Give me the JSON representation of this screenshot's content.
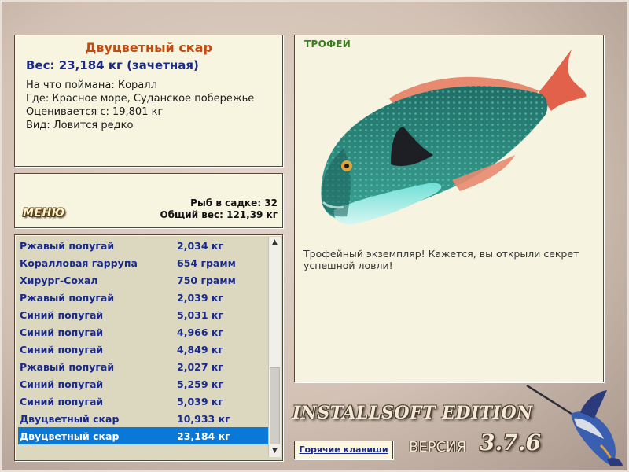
{
  "info": {
    "title": "Двуцветный скар",
    "weight": "Вес: 23,184 кг (зачетная)",
    "lines": [
      "На что поймана: Коралл",
      "Где: Красное море, Суданское побережье",
      "Оценивается с: 19,801 кг",
      "Вид: Ловится редко"
    ]
  },
  "menu": {
    "button_label": "МЕНЮ",
    "fish_count": "Рыб в садке: 32",
    "total_weight": "Общий вес: 121,39 кг"
  },
  "catch_list": [
    {
      "name": "Ржавый попугай",
      "weight": "2,034 кг"
    },
    {
      "name": "Коралловая гаррупа",
      "weight": "654 грамм"
    },
    {
      "name": "Хирург-Сохал",
      "weight": "750 грамм"
    },
    {
      "name": "Ржавый попугай",
      "weight": "2,039 кг"
    },
    {
      "name": "Синий попугай",
      "weight": "5,031 кг"
    },
    {
      "name": "Синий попугай",
      "weight": "4,966 кг"
    },
    {
      "name": "Синий попугай",
      "weight": "4,849 кг"
    },
    {
      "name": "Ржавый попугай",
      "weight": "2,027 кг"
    },
    {
      "name": "Синий попугай",
      "weight": "5,259 кг"
    },
    {
      "name": "Синий попугай",
      "weight": "5,039 кг"
    },
    {
      "name": "Двуцветный скар",
      "weight": "10,933 кг"
    },
    {
      "name": "Двуцветный скар",
      "weight": "23,184 кг"
    }
  ],
  "selected_index": 11,
  "trophy": {
    "label": "ТРОФЕЙ",
    "text": "Трофейный экземпляр! Кажется, вы открыли секрет успешной ловли!"
  },
  "branding": {
    "edition": "INSTALLSOFT EDITION",
    "version_label": "ВЕРСИЯ",
    "version_number": "3.7.6"
  },
  "hotkeys_label": "Горячие клавиши",
  "colors": {
    "title": "#c24b12",
    "list_text": "#1a2a8a",
    "selection": "#0a78d8",
    "trophy_label": "#3a7e1e"
  },
  "icons": {
    "fish_image": "bicolor-parrotfish",
    "logo": "marlin"
  }
}
